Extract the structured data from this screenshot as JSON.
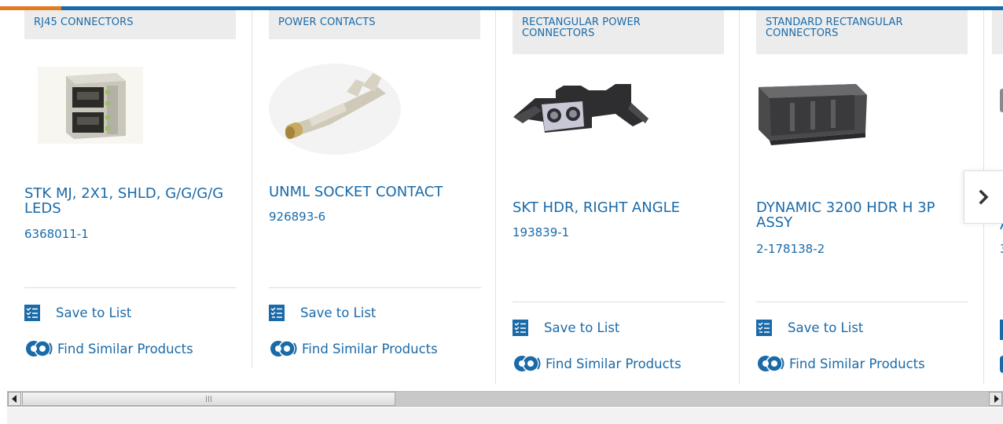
{
  "colors": {
    "brand_blue": "#1a6aa8",
    "accent_orange": "#e07a1f",
    "category_bg": "#ececec"
  },
  "products": [
    {
      "category": "RJ45 CONNECTORS",
      "title": "STK MJ, 2X1, SHLD, G/G/G/G LEDS",
      "part_number": "6368011-1",
      "save_label": "Save to List",
      "similar_label": "Find Similar Products",
      "image_icon": "rj45-jack-image"
    },
    {
      "category": "POWER CONTACTS",
      "title": "UNML SOCKET CONTACT",
      "part_number": "926893-6",
      "save_label": "Save to List",
      "similar_label": "Find Similar Products",
      "image_icon": "socket-contact-image"
    },
    {
      "category": "RECTANGULAR POWER CONNECTORS",
      "title": "SKT HDR, RIGHT ANGLE",
      "part_number": "193839-1",
      "save_label": "Save to List",
      "similar_label": "Find Similar Products",
      "image_icon": "power-header-image"
    },
    {
      "category": "STANDARD RECTANGULAR CONNECTORS",
      "title": "DYNAMIC 3200 HDR H 3P ASSY",
      "part_number": "2-178138-2",
      "save_label": "Save to List",
      "similar_label": "Find Similar Products",
      "image_icon": "rectangular-header-image"
    }
  ],
  "partial_card": {
    "title_fragment": "A",
    "part_fragment": "3"
  },
  "carousel": {
    "next_icon": "chevron-right-icon"
  },
  "scrollbar": {
    "left_icon": "arrow-left-icon",
    "right_icon": "arrow-right-icon"
  }
}
